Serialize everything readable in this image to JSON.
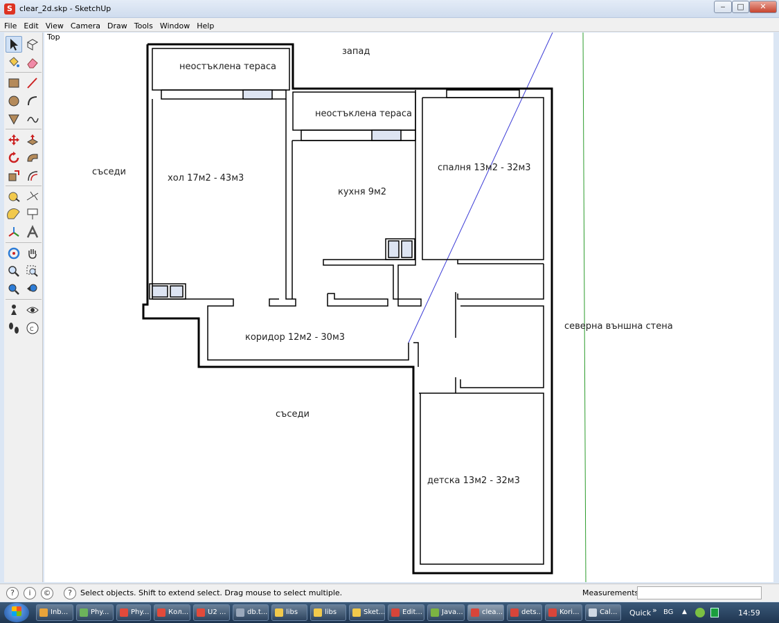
{
  "window": {
    "title": "clear_2d.skp - SketchUp",
    "app_icon": "sketchup-icon",
    "controls": {
      "minimize": "‒",
      "maximize": "□",
      "close": "✕"
    }
  },
  "menu": [
    "File",
    "Edit",
    "View",
    "Camera",
    "Draw",
    "Tools",
    "Window",
    "Help"
  ],
  "tools": [
    "select-icon",
    "make-component-icon",
    "paint-bucket-icon",
    "eraser-icon",
    "rectangle-icon",
    "line-icon",
    "circle-icon",
    "arc-icon",
    "polygon-icon",
    "freehand-icon",
    "move-icon",
    "push-pull-icon",
    "rotate-icon",
    "follow-me-icon",
    "scale-icon",
    "offset-icon",
    "tape-measure-icon",
    "dimension-icon",
    "protractor-icon",
    "text-icon",
    "axes-icon",
    "3d-text-icon",
    "orbit-icon",
    "pan-icon",
    "zoom-icon",
    "zoom-window-icon",
    "zoom-extents-icon",
    "previous-view-icon",
    "position-camera-icon",
    "look-around-icon",
    "walk-icon",
    "section-plane-icon"
  ],
  "viewport": {
    "view_name": "Top",
    "labels": {
      "terrace1": "неостъклена тераса",
      "terrace2": "неостъклена тераса",
      "west": "запад",
      "neighbors_left": "съседи",
      "living": "хол 17м2 - 43м3",
      "kitchen": "кухня 9м2",
      "bedroom": "спалня 13м2 - 32м3",
      "corridor": "коридор 12м2 - 30м3",
      "north_wall": "северна външна стена",
      "neighbors_bottom": "съседи",
      "kids": "детска 13м2 - 32м3"
    }
  },
  "statusbar": {
    "icons": [
      "geo-location-icon",
      "credits-icon",
      "sign-in-icon",
      "help-icon"
    ],
    "hint": "Select objects. Shift to extend select. Drag mouse to select multiple.",
    "measurements_label": "Measurements",
    "measurements_value": ""
  },
  "taskbar": {
    "items": [
      {
        "label": "Inb...",
        "color": "#e8a33a"
      },
      {
        "label": "Phy...",
        "color": "#6db35b"
      },
      {
        "label": "Phy...",
        "color": "#e24a3b"
      },
      {
        "label": "Кол...",
        "color": "#e24a3b"
      },
      {
        "label": "U2 ...",
        "color": "#e24a3b"
      },
      {
        "label": "db.t...",
        "color": "#9aa8bb"
      },
      {
        "label": "libs",
        "color": "#f1c94b"
      },
      {
        "label": "libs",
        "color": "#f1c94b"
      },
      {
        "label": "Sket...",
        "color": "#f1c94b"
      },
      {
        "label": "Edit...",
        "color": "#d8453a"
      },
      {
        "label": "Java...",
        "color": "#7cb342"
      },
      {
        "label": "clea...",
        "color": "#d8453a",
        "active": true
      },
      {
        "label": "dets...",
        "color": "#d8453a"
      },
      {
        "label": "Kori...",
        "color": "#d8453a"
      },
      {
        "label": "Cal...",
        "color": "#cfd8e3"
      }
    ],
    "quick_launch": "Quick",
    "quick_chevron": "»",
    "language": "BG",
    "tray_up": "▲",
    "clock": "14:59"
  }
}
